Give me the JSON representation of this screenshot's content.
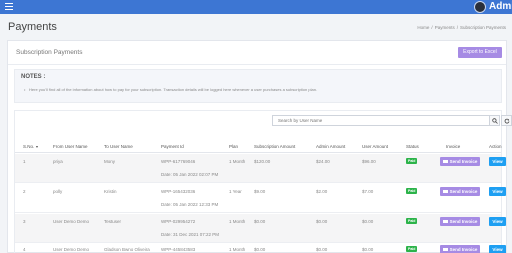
{
  "topbar": {
    "user": "Admin",
    "menu_icon": "hamburger-icon"
  },
  "page": {
    "title": "Payments"
  },
  "breadcrumb": {
    "home": "Home",
    "payments": "Payments",
    "current": "Subscription Payments"
  },
  "card": {
    "title": "Subscription Payments",
    "export_label": "Export to Excel"
  },
  "notes": {
    "title": "NOTES :",
    "text": "Here you'll find all of the information about how to pay for your subscription. Transaction details will be logged here whenever a user purchases a subscription plan."
  },
  "search": {
    "placeholder": "Search by User Name"
  },
  "columns": {
    "sno": "S.No.",
    "from_user": "From User Name",
    "to_user": "To User Name",
    "payment_id": "Payment Id",
    "plan": "Plan",
    "sub_amount": "Subscription Amount",
    "admin_amount": "Admin Amount",
    "user_amount": "User Amount",
    "status": "Status",
    "invoice": "Invoice",
    "action": "Action"
  },
  "buttons": {
    "send_invoice": "Send Invoice",
    "view": "View"
  },
  "rows": [
    {
      "sno": "1",
      "from_user": "priya",
      "to_user": "Mony",
      "payment_id": "WPP-617769046",
      "date": "Date: 05 Jan 2022 02:07 PM",
      "plan": "1 Month",
      "sub_amount": "$120.00",
      "admin_amount": "$24.00",
      "user_amount": "$96.00",
      "status": "Paid"
    },
    {
      "sno": "2",
      "from_user": "polly",
      "to_user": "Kristin",
      "payment_id": "WPP-165432036",
      "date": "Date: 05 Jan 2022 12:33 PM",
      "plan": "1 Year",
      "sub_amount": "$9.00",
      "admin_amount": "$2.00",
      "user_amount": "$7.00",
      "status": "Paid"
    },
    {
      "sno": "3",
      "from_user": "User Demo Demo",
      "to_user": "Testuser",
      "payment_id": "WPP-029954272",
      "date": "Date: 31 Dec 2021 07:22 PM",
      "plan": "1 Month",
      "sub_amount": "$0.00",
      "admin_amount": "$0.00",
      "user_amount": "$0.00",
      "status": "Paid"
    },
    {
      "sno": "4",
      "from_user": "User Demo Demo",
      "to_user": "Gladson Bwno Oliveira",
      "payment_id": "WPP-445843583",
      "date": "",
      "plan": "1 Month",
      "sub_amount": "$0.00",
      "admin_amount": "$0.00",
      "user_amount": "$0.00",
      "status": "Paid"
    }
  ]
}
